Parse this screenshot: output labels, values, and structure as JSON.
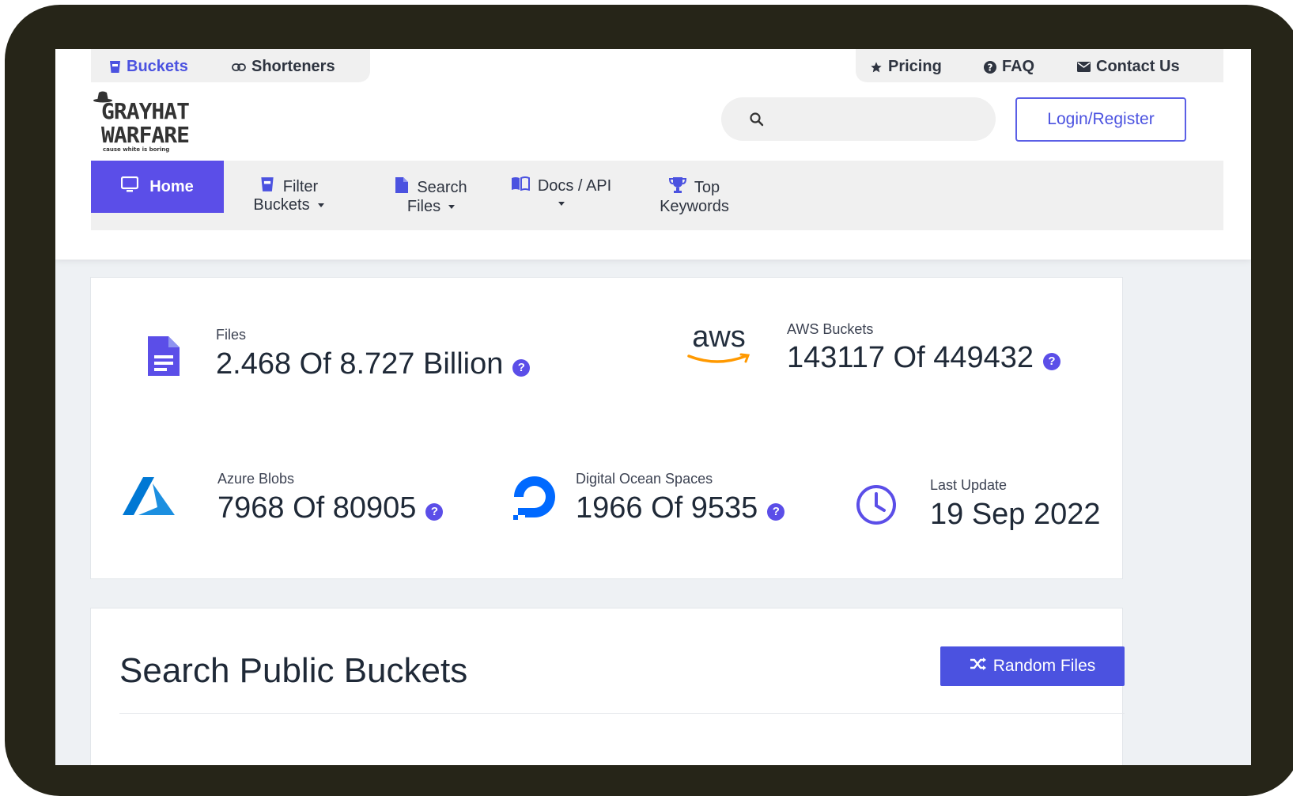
{
  "top_nav": {
    "left": [
      {
        "label": "Buckets",
        "icon": "bucket-icon",
        "active": true
      },
      {
        "label": "Shorteners",
        "icon": "link-icon",
        "active": false
      }
    ],
    "right": [
      {
        "label": "Pricing",
        "icon": "star-icon"
      },
      {
        "label": "FAQ",
        "icon": "question-circle-icon"
      },
      {
        "label": "Contact Us",
        "icon": "envelope-icon"
      }
    ]
  },
  "logo": {
    "line1": "GRAYHAT",
    "line2": "WARFARE",
    "tagline": "cause white is boring"
  },
  "search": {
    "placeholder": "",
    "value": "",
    "icon": "search-icon"
  },
  "login_label": "Login/Register",
  "main_nav": {
    "home": {
      "label": "Home",
      "icon": "monitor-icon"
    },
    "items": [
      {
        "line1": "Filter",
        "line2": "Buckets",
        "icon": "bucket-icon",
        "dropdown": true
      },
      {
        "line1": "Search",
        "line2": "Files",
        "icon": "file-icon",
        "dropdown": true
      },
      {
        "line1": "Docs / API",
        "line2": "",
        "icon": "book-icon",
        "dropdown": true
      },
      {
        "line1": "Top",
        "line2": "Keywords",
        "icon": "trophy-icon",
        "dropdown": false
      }
    ]
  },
  "stats": {
    "files": {
      "label": "Files",
      "value": "2.468 Of 8.727 Billion",
      "icon": "file-icon"
    },
    "aws": {
      "label": "AWS Buckets",
      "value": "143117 Of 449432",
      "logo_text": "aws"
    },
    "azure": {
      "label": "Azure Blobs",
      "value": "7968 Of 80905",
      "icon": "azure-icon"
    },
    "digitalocean": {
      "label": "Digital Ocean Spaces",
      "value": "1966 Of 9535",
      "icon": "digitalocean-icon"
    },
    "last_update": {
      "label": "Last Update",
      "value": "19 Sep 2022",
      "icon": "clock-icon"
    }
  },
  "search_section": {
    "title": "Search Public Buckets",
    "random_button": "Random Files",
    "random_icon": "shuffle-icon"
  },
  "colors": {
    "accent": "#5b4ee8",
    "button": "#4b52e0",
    "frame": "#262518",
    "text": "#1f2937"
  }
}
